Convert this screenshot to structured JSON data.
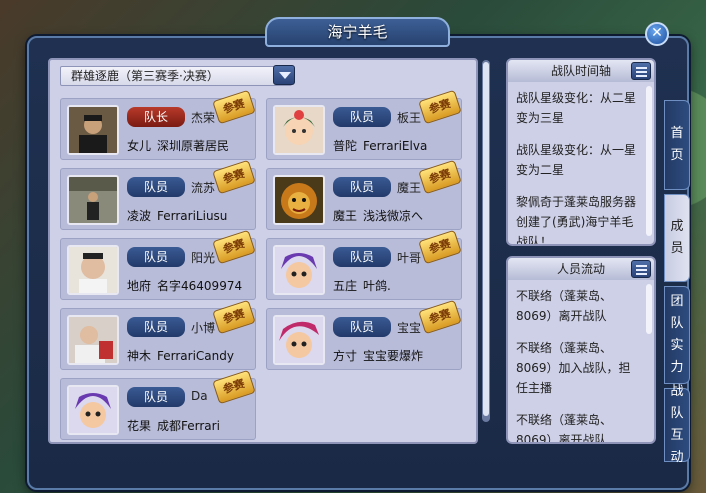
{
  "window": {
    "title": "海宁羊毛",
    "close_label": "✕"
  },
  "season_select": {
    "value": "群雄逐鹿（第三赛季·决赛）"
  },
  "members": [
    {
      "role": "队长",
      "name": "杰荣",
      "school": "女儿",
      "nickname": "深圳原著居民",
      "stamp": "参赛",
      "avatar": "photo-man-dark"
    },
    {
      "role": "队员",
      "name": "板王",
      "school": "普陀",
      "nickname": "FerrariElva",
      "stamp": "参赛",
      "avatar": "fairy-girl"
    },
    {
      "role": "队员",
      "name": "流苏",
      "school": "凌波",
      "nickname": "FerrariLiusu",
      "stamp": "参赛",
      "avatar": "photo-man-street"
    },
    {
      "role": "队员",
      "name": "魔王",
      "school": "魔王",
      "nickname": "浅浅微凉へ",
      "stamp": "参赛",
      "avatar": "demon-lion"
    },
    {
      "role": "队员",
      "name": "阳光",
      "school": "地府",
      "nickname": "名字46409974",
      "stamp": "参赛",
      "avatar": "photo-man-face"
    },
    {
      "role": "队员",
      "name": "叶哥",
      "school": "五庄",
      "nickname": "叶鸽.",
      "stamp": "参赛",
      "avatar": "purple-hair-boy"
    },
    {
      "role": "队员",
      "name": "小博",
      "school": "神木",
      "nickname": "FerrariCandy",
      "stamp": "参赛",
      "avatar": "photo-child"
    },
    {
      "role": "队员",
      "name": "宝宝",
      "school": "方寸",
      "nickname": "宝宝要爆炸",
      "stamp": "参赛",
      "avatar": "red-hair-boy"
    },
    {
      "role": "队员",
      "name": "Da",
      "school": "花果",
      "nickname": "成都Ferrari",
      "stamp": "参赛",
      "avatar": "purple-hair-boy"
    }
  ],
  "timeline": {
    "title": "战队时间轴",
    "entries": [
      "战队星级变化：从二星变为三星",
      "战队星级变化：从一星变为二星",
      "黎佩奇于蓬莱岛服务器创建了(勇武)海宁羊毛战队！"
    ]
  },
  "flow": {
    "title": "人员流动",
    "entries": [
      "不联络（蓬莱岛、8069）离开战队",
      "不联络（蓬莱岛、8069）加入战队，担任主播",
      "不联络（蓬莱岛、8069）离开战队"
    ]
  },
  "tabs": [
    {
      "label": "首页",
      "active": false
    },
    {
      "label": "成员",
      "active": true
    },
    {
      "label": "团队实力",
      "active": false
    },
    {
      "label": "战队互动",
      "active": false
    }
  ],
  "colors": {
    "panel_bg": "#cdd0e6",
    "card_bg": "#b8bcd8",
    "leader_badge": "#b83a2a",
    "member_badge": "#2e4c80",
    "stamp": "#e8b030"
  }
}
